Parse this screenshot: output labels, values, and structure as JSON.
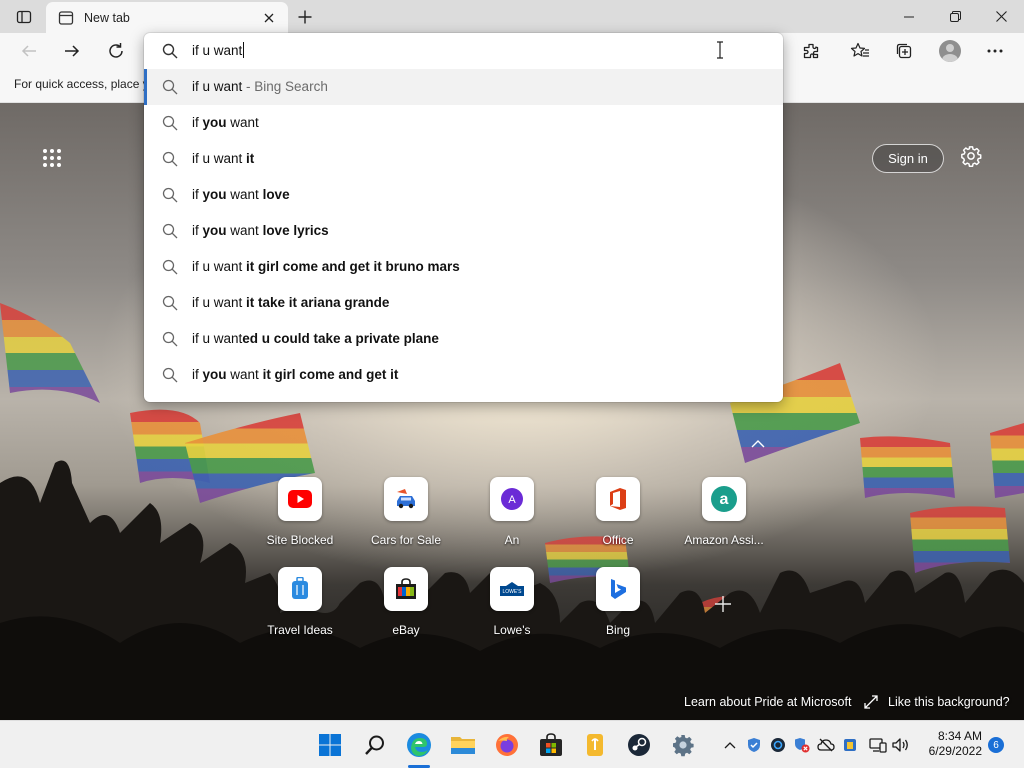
{
  "tab": {
    "title": "New tab"
  },
  "favorites_bar": {
    "text": "For quick access, place y"
  },
  "address": {
    "typed": "if u want"
  },
  "suggestions": [
    {
      "parts": [
        {
          "t": "if u want",
          "b": false
        }
      ],
      "suffix": " - Bing Search"
    },
    {
      "parts": [
        {
          "t": "if ",
          "b": false
        },
        {
          "t": "you",
          "b": true
        },
        {
          "t": " want",
          "b": false
        }
      ]
    },
    {
      "parts": [
        {
          "t": "if u want ",
          "b": false
        },
        {
          "t": "it",
          "b": true
        }
      ]
    },
    {
      "parts": [
        {
          "t": "if ",
          "b": false
        },
        {
          "t": "you",
          "b": true
        },
        {
          "t": " want ",
          "b": false
        },
        {
          "t": "love",
          "b": true
        }
      ]
    },
    {
      "parts": [
        {
          "t": "if ",
          "b": false
        },
        {
          "t": "you",
          "b": true
        },
        {
          "t": " want ",
          "b": false
        },
        {
          "t": "love lyrics",
          "b": true
        }
      ]
    },
    {
      "parts": [
        {
          "t": "if u want ",
          "b": false
        },
        {
          "t": "it girl come and get it bruno mars",
          "b": true
        }
      ]
    },
    {
      "parts": [
        {
          "t": "if u want ",
          "b": false
        },
        {
          "t": "it take it ariana grande",
          "b": true
        }
      ]
    },
    {
      "parts": [
        {
          "t": "if u want",
          "b": false
        },
        {
          "t": "ed u could take a private plane",
          "b": true
        }
      ]
    },
    {
      "parts": [
        {
          "t": "if ",
          "b": false
        },
        {
          "t": "you",
          "b": true
        },
        {
          "t": " want ",
          "b": false
        },
        {
          "t": "it girl come and get it",
          "b": true
        }
      ]
    }
  ],
  "page": {
    "sign_in": "Sign in",
    "learn_link": "Learn about Pride at Microsoft",
    "like_link": "Like this background?"
  },
  "quick_links": [
    {
      "label": "Site Blocked",
      "icon": "youtube-icon"
    },
    {
      "label": "Cars for Sale",
      "icon": "car-icon"
    },
    {
      "label": "An",
      "icon": "letter-a-icon"
    },
    {
      "label": "Office",
      "icon": "office-icon"
    },
    {
      "label": "Amazon Assi...",
      "icon": "amazon-icon"
    },
    {
      "label": "Travel Ideas",
      "icon": "luggage-icon"
    },
    {
      "label": "eBay",
      "icon": "shopping-bag-icon"
    },
    {
      "label": "Lowe's",
      "icon": "lowes-icon"
    },
    {
      "label": "Bing",
      "icon": "bing-icon"
    }
  ],
  "clock": {
    "time": "8:34 AM",
    "date": "6/29/2022"
  },
  "notifications": {
    "count": "6"
  },
  "colors": {
    "accent": "#2f6fc4",
    "taskbar": "#f0f0f0",
    "notif_badge": "#1a6fd6"
  }
}
